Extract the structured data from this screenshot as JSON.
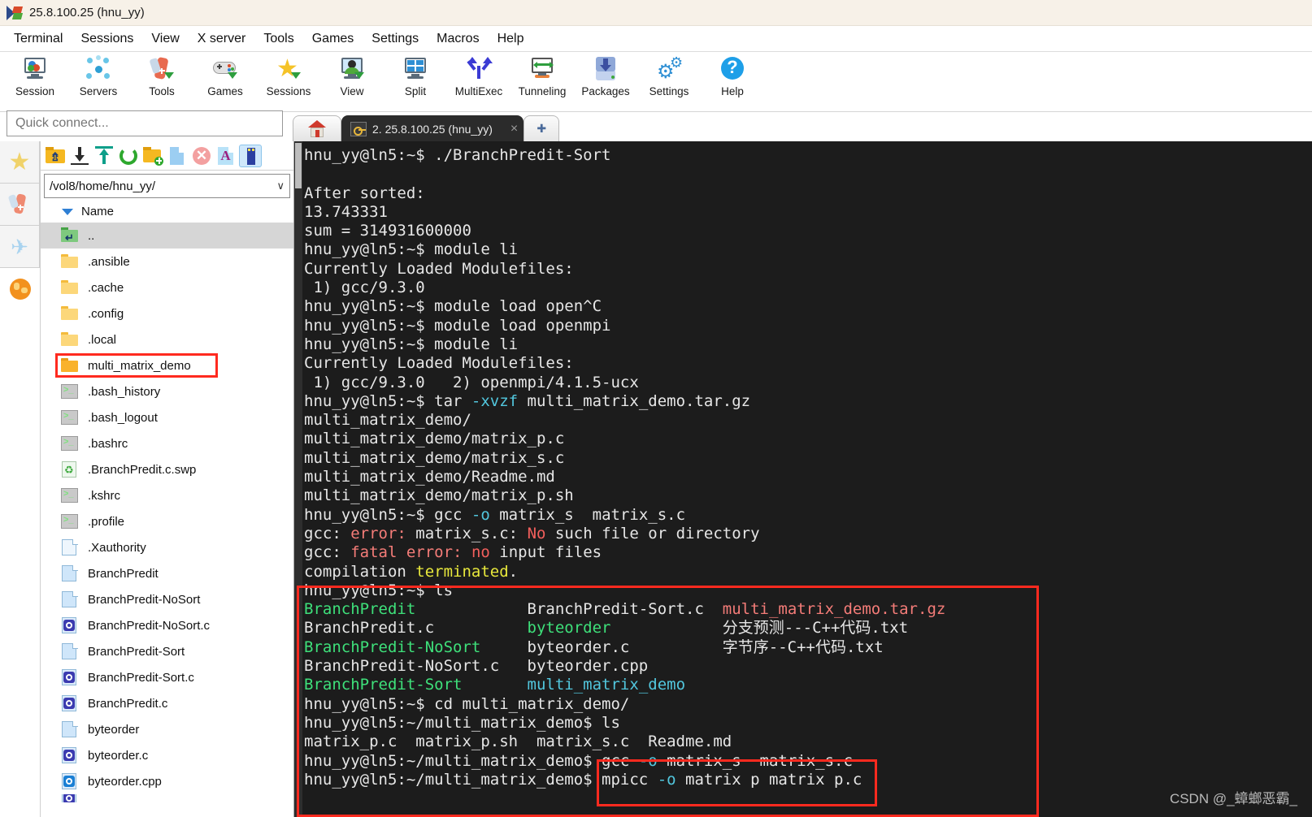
{
  "window": {
    "title": "25.8.100.25 (hnu_yy)",
    "app_icon": "mobaxterm-icon"
  },
  "menubar": {
    "items": [
      "Terminal",
      "Sessions",
      "View",
      "X server",
      "Tools",
      "Games",
      "Settings",
      "Macros",
      "Help"
    ]
  },
  "toolbar": {
    "buttons": [
      {
        "label": "Session",
        "icon": "session-icon"
      },
      {
        "label": "Servers",
        "icon": "servers-icon"
      },
      {
        "label": "Tools",
        "icon": "tools-icon"
      },
      {
        "label": "Games",
        "icon": "gamepad-icon"
      },
      {
        "label": "Sessions",
        "icon": "star-icon"
      },
      {
        "label": "View",
        "icon": "view-icon"
      },
      {
        "label": "Split",
        "icon": "split-icon"
      },
      {
        "label": "MultiExec",
        "icon": "multiexec-icon"
      },
      {
        "label": "Tunneling",
        "icon": "tunneling-icon"
      },
      {
        "label": "Packages",
        "icon": "packages-icon"
      },
      {
        "label": "Settings",
        "icon": "gear-icon"
      },
      {
        "label": "Help",
        "icon": "help-icon"
      }
    ]
  },
  "tabs": {
    "home_icon": "home-icon",
    "active_label": "2. 25.8.100.25 (hnu_yy)",
    "close_glyph": "×",
    "new_tab_glyph": "✚"
  },
  "quick_connect": {
    "placeholder": "Quick connect...",
    "value": ""
  },
  "rail": {
    "items": [
      {
        "name": "favorites-star-icon"
      },
      {
        "name": "tools-knife-icon"
      },
      {
        "name": "send-plane-icon"
      },
      {
        "name": "globe-icon"
      }
    ]
  },
  "file_panel": {
    "toolbar_icons": [
      "parent-folder-icon",
      "download-icon",
      "upload-icon",
      "refresh-icon",
      "new-folder-icon",
      "new-file-icon",
      "delete-icon",
      "text-mode-icon",
      "usb-drive-icon"
    ],
    "path": "/vol8/home/hnu_yy/",
    "path_chevron": "∨",
    "column_header": "Name",
    "rows": [
      {
        "name": "..",
        "icon": "up-folder-icon",
        "kind": "up",
        "selected": true,
        "highlighted": false
      },
      {
        "name": ".ansible",
        "icon": "folder-icon",
        "kind": "folder",
        "selected": false,
        "highlighted": false
      },
      {
        "name": ".cache",
        "icon": "folder-icon",
        "kind": "folder",
        "selected": false,
        "highlighted": false
      },
      {
        "name": ".config",
        "icon": "folder-icon",
        "kind": "folder",
        "selected": false,
        "highlighted": false
      },
      {
        "name": ".local",
        "icon": "folder-icon",
        "kind": "folder",
        "selected": false,
        "highlighted": false
      },
      {
        "name": "multi_matrix_demo",
        "icon": "folder-icon",
        "kind": "folder-deep",
        "selected": false,
        "highlighted": true
      },
      {
        "name": ".bash_history",
        "icon": "script-icon",
        "kind": "script",
        "selected": false,
        "highlighted": false
      },
      {
        "name": ".bash_logout",
        "icon": "script-icon",
        "kind": "script",
        "selected": false,
        "highlighted": false
      },
      {
        "name": ".bashrc",
        "icon": "script-icon",
        "kind": "script",
        "selected": false,
        "highlighted": false
      },
      {
        "name": ".BranchPredit.c.swp",
        "icon": "swap-file-icon",
        "kind": "swp",
        "selected": false,
        "highlighted": false
      },
      {
        "name": ".kshrc",
        "icon": "script-icon",
        "kind": "script",
        "selected": false,
        "highlighted": false
      },
      {
        "name": ".profile",
        "icon": "script-icon",
        "kind": "script",
        "selected": false,
        "highlighted": false
      },
      {
        "name": ".Xauthority",
        "icon": "document-icon",
        "kind": "doc-pale",
        "selected": false,
        "highlighted": false
      },
      {
        "name": "BranchPredit",
        "icon": "document-icon",
        "kind": "doc",
        "selected": false,
        "highlighted": false
      },
      {
        "name": "BranchPredit-NoSort",
        "icon": "document-icon",
        "kind": "doc",
        "selected": false,
        "highlighted": false
      },
      {
        "name": "BranchPredit-NoSort.c",
        "icon": "c-source-icon",
        "kind": "c",
        "selected": false,
        "highlighted": false
      },
      {
        "name": "BranchPredit-Sort",
        "icon": "document-icon",
        "kind": "doc",
        "selected": false,
        "highlighted": false
      },
      {
        "name": "BranchPredit-Sort.c",
        "icon": "c-source-icon",
        "kind": "c",
        "selected": false,
        "highlighted": false
      },
      {
        "name": "BranchPredit.c",
        "icon": "c-source-icon",
        "kind": "c",
        "selected": false,
        "highlighted": false
      },
      {
        "name": "byteorder",
        "icon": "document-icon",
        "kind": "doc",
        "selected": false,
        "highlighted": false
      },
      {
        "name": "byteorder.c",
        "icon": "c-source-icon",
        "kind": "c",
        "selected": false,
        "highlighted": false
      },
      {
        "name": "byteorder.cpp",
        "icon": "cpp-source-icon",
        "kind": "cpp",
        "selected": false,
        "highlighted": false
      }
    ]
  },
  "terminal": {
    "lines": [
      [
        {
          "t": "hnu_yy@ln5:~$ ./BranchPredit-Sort",
          "c": "t-white"
        }
      ],
      [
        {
          "t": "",
          "c": "t-white"
        }
      ],
      [
        {
          "t": "After sorted:",
          "c": "t-white"
        }
      ],
      [
        {
          "t": "13.743331",
          "c": "t-white"
        }
      ],
      [
        {
          "t": "sum = 314931600000",
          "c": "t-white"
        }
      ],
      [
        {
          "t": "hnu_yy@ln5:~$ module li",
          "c": "t-white"
        }
      ],
      [
        {
          "t": "Currently Loaded Modulefiles:",
          "c": "t-white"
        }
      ],
      [
        {
          "t": " 1) gcc/9.3.0",
          "c": "t-white"
        }
      ],
      [
        {
          "t": "hnu_yy@ln5:~$ module load open^C",
          "c": "t-white"
        }
      ],
      [
        {
          "t": "hnu_yy@ln5:~$ module load openmpi",
          "c": "t-white"
        }
      ],
      [
        {
          "t": "hnu_yy@ln5:~$ module li",
          "c": "t-white"
        }
      ],
      [
        {
          "t": "Currently Loaded Modulefiles:",
          "c": "t-white"
        }
      ],
      [
        {
          "t": " 1) gcc/9.3.0   2) openmpi/4.1.5-ucx",
          "c": "t-white"
        }
      ],
      [
        {
          "t": "hnu_yy@ln5:~$ tar ",
          "c": "t-white"
        },
        {
          "t": "-xvzf",
          "c": "t-cyan"
        },
        {
          "t": " multi_matrix_demo.tar.gz",
          "c": "t-white"
        }
      ],
      [
        {
          "t": "multi_matrix_demo/",
          "c": "t-white"
        }
      ],
      [
        {
          "t": "multi_matrix_demo/matrix_p.c",
          "c": "t-white"
        }
      ],
      [
        {
          "t": "multi_matrix_demo/matrix_s.c",
          "c": "t-white"
        }
      ],
      [
        {
          "t": "multi_matrix_demo/Readme.md",
          "c": "t-white"
        }
      ],
      [
        {
          "t": "multi_matrix_demo/matrix_p.sh",
          "c": "t-white"
        }
      ],
      [
        {
          "t": "hnu_yy@ln5:~$ gcc ",
          "c": "t-white"
        },
        {
          "t": "-o",
          "c": "t-cyan"
        },
        {
          "t": " matrix_s  matrix_s.c",
          "c": "t-white"
        }
      ],
      [
        {
          "t": "gcc: ",
          "c": "t-white"
        },
        {
          "t": "error:",
          "c": "t-salmon"
        },
        {
          "t": " matrix_s.c: ",
          "c": "t-white"
        },
        {
          "t": "No",
          "c": "t-red"
        },
        {
          "t": " such file or directory",
          "c": "t-white"
        }
      ],
      [
        {
          "t": "gcc: ",
          "c": "t-white"
        },
        {
          "t": "fatal error:",
          "c": "t-salmon"
        },
        {
          "t": " ",
          "c": "t-white"
        },
        {
          "t": "no",
          "c": "t-red"
        },
        {
          "t": " input files",
          "c": "t-white"
        }
      ],
      [
        {
          "t": "compilation ",
          "c": "t-white"
        },
        {
          "t": "terminated",
          "c": "t-yellow"
        },
        {
          "t": ".",
          "c": "t-white"
        }
      ],
      [
        {
          "t": "hnu_yy@ln5:~$ ls",
          "c": "t-white"
        }
      ],
      [
        {
          "t": "BranchPredit",
          "c": "t-green"
        },
        {
          "t": "            BranchPredit-Sort.c  ",
          "c": "t-white"
        },
        {
          "t": "multi_matrix_demo.tar.gz",
          "c": "t-salmon"
        }
      ],
      [
        {
          "t": "BranchPredit.c          ",
          "c": "t-white"
        },
        {
          "t": "byteorder",
          "c": "t-green"
        },
        {
          "t": "            分支预测---C++代码.txt",
          "c": "t-white"
        }
      ],
      [
        {
          "t": "BranchPredit-NoSort",
          "c": "t-green"
        },
        {
          "t": "     byteorder.c          字节序--C++代码.txt",
          "c": "t-white"
        }
      ],
      [
        {
          "t": "BranchPredit-NoSort.c   byteorder.cpp",
          "c": "t-white"
        }
      ],
      [
        {
          "t": "BranchPredit-Sort",
          "c": "t-green"
        },
        {
          "t": "       ",
          "c": "t-white"
        },
        {
          "t": "multi_matrix_demo",
          "c": "t-cyan"
        }
      ],
      [
        {
          "t": "hnu_yy@ln5:~$ cd multi_matrix_demo/",
          "c": "t-white"
        }
      ],
      [
        {
          "t": "hnu_yy@ln5:~/multi_matrix_demo$ ls",
          "c": "t-white"
        }
      ],
      [
        {
          "t": "matrix_p.c  matrix_p.sh  matrix_s.c  Readme.md",
          "c": "t-white"
        }
      ],
      [
        {
          "t": "hnu_yy@ln5:~/multi_matrix_demo$ gcc ",
          "c": "t-white"
        },
        {
          "t": "-o",
          "c": "t-cyan"
        },
        {
          "t": " matrix_s  matrix_s.c",
          "c": "t-white"
        }
      ],
      [
        {
          "t": "hnu_yy@ln5:~/multi_matrix_demo$ mpicc ",
          "c": "t-white"
        },
        {
          "t": "-o",
          "c": "t-cyan"
        },
        {
          "t": " matrix p matrix p.c",
          "c": "t-white"
        }
      ]
    ]
  },
  "annotations": {
    "boxes": [
      {
        "name": "annot-box-ls-output"
      },
      {
        "name": "annot-box-compile-commands"
      },
      {
        "name": "annot-box-multi-matrix-demo-folder"
      }
    ]
  },
  "watermark": {
    "text": "CSDN @_蟑螂恶霸_"
  }
}
